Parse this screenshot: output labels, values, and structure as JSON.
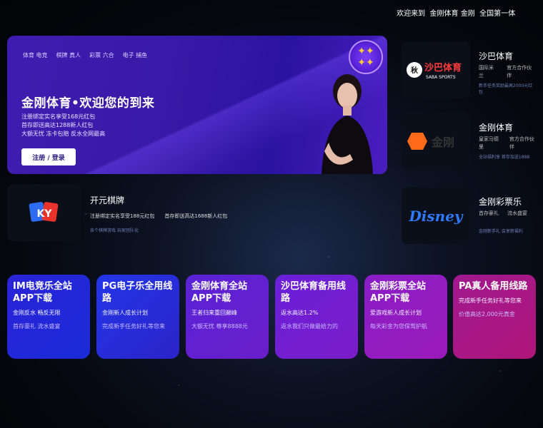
{
  "topbar": {
    "text": "￼ 欢迎来到 ￼ 金刚体育 ￼金刚 ￼ 全国第一体"
  },
  "hero": {
    "nav": [
      "￼体育 电竞",
      "￼棋牌 真人",
      "￼彩票 六合",
      "￼电子 捕鱼"
    ],
    "title": "金刚体育•欢迎您的到来",
    "lines": [
      "￼注册绑定实名享受168元红包",
      "￼首存即送高达1288新人红包",
      "￼大额无忧 冻卡包赔 反水全网最高"
    ],
    "button": "注册 / 登录",
    "badge_icon": "star-badge-icon"
  },
  "cards": {
    "saba": {
      "logo_text": "沙巴体育",
      "logo_sub": "SABA SPORTS",
      "name": "沙巴体育",
      "meta": [
        "国际米兰",
        "官方合作伙伴"
      ],
      "sub": "新手任务奖励最高2000元红包"
    },
    "jingang": {
      "logo_text": "金刚",
      "name": "金刚体育",
      "meta": [
        "皇家马德里",
        "官方合作伙伴"
      ],
      "sub": "全站福利享 首存加送1888"
    },
    "ky": {
      "logo_text": "KY",
      "name": "开元棋牌",
      "meta": [
        "￼注册绑定实名享受188元红包",
        "￼首存即送高达1688新人红包"
      ],
      "sub": "￼各个棋牌游戏 玩家团队化"
    },
    "disney": {
      "logo_text": "Disney",
      "name": "金刚彩票乐",
      "meta": [
        "首存豪礼",
        "流水盛宴"
      ],
      "sub": "金刚新手礼 会享新福利"
    }
  },
  "tiles": [
    {
      "title": "IM电竞乐全站\nAPP下载",
      "l1": "金刚反水 畅反无限",
      "l2": "首存豪礼 流水盛宴",
      "c1": "#2a23d8",
      "c2": "#1a2bd8"
    },
    {
      "title": "PG电子乐全用线\n路",
      "l1": "金刚新人成长计划",
      "l2": "完成新手任务好礼等您来",
      "c1": "#2436e8",
      "c2": "#2a23c8"
    },
    {
      "title": "金刚体育全站\nAPP下载",
      "l1": "王者归来重回巅峰",
      "l2": "大额无忧 尊享8888元",
      "c1": "#5a22d8",
      "c2": "#6a1ec8"
    },
    {
      "title": "沙巴体育备用线\n路",
      "l1": "返水高达1.2%",
      "l2": "返水我们只做最给力的",
      "c1": "#6a1fd8",
      "c2": "#7b1dc8"
    },
    {
      "title": "金刚彩票全站\nAPP下载",
      "l1": "爱游戏新人成长计划",
      "l2": "每天彩金为您保驾护航",
      "c1": "#8a1dc8",
      "c2": "#9a1ab8"
    },
    {
      "title": "PA真人备用线路",
      "l1": "完成新手任务好礼等您来",
      "l2": "价值高达2,000元真金",
      "c1": "#a0188f",
      "c2": "#b0167a"
    }
  ]
}
